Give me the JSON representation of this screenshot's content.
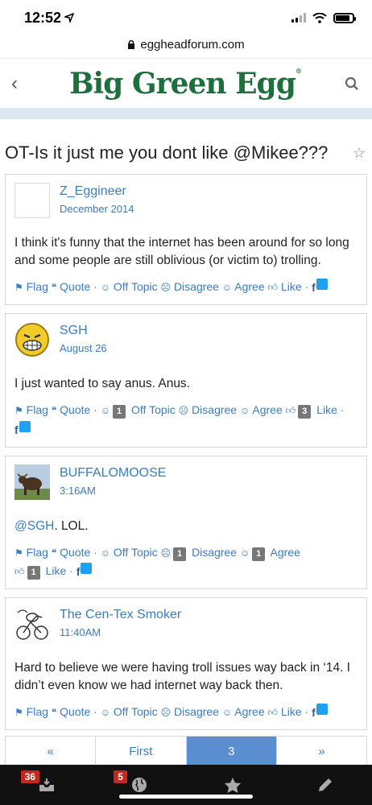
{
  "status": {
    "time": "12:52"
  },
  "browser": {
    "url": "eggheadforum.com"
  },
  "header": {
    "logo": "Big Green Egg"
  },
  "thread": {
    "title": "OT-Is it just me you dont like @Mikee???"
  },
  "reaction_labels": {
    "flag": "Flag",
    "quote": "Quote",
    "off_topic": "Off Topic",
    "disagree": "Disagree",
    "agree": "Agree",
    "like": "Like"
  },
  "posts": [
    {
      "author": "Z_Eggineer",
      "date": "December 2014",
      "body": "I think it's funny that the internet has been around for so long and some people are still oblivious (or victim to) trolling."
    },
    {
      "author": "SGH",
      "date": "August 26",
      "body": "I just wanted to say anus.  Anus.",
      "counts": {
        "off_topic": "1",
        "like": "3"
      }
    },
    {
      "author": "BUFFALOMOOSE",
      "date": "3:16AM",
      "mention": "@SGH",
      "body": ". LOL.",
      "counts": {
        "disagree": "1",
        "agree": "1",
        "like": "1"
      }
    },
    {
      "author": "The Cen-Tex Smoker",
      "date": "11:40AM",
      "body": "Hard to believe we were having troll issues way back in ‘14. I didn’t even know we had internet way back then."
    }
  ],
  "pager": {
    "prev": "«",
    "first": "First",
    "current": "3",
    "next": "»"
  },
  "bottom_bar": {
    "inbox_badge": "36",
    "notifications_badge": "5"
  }
}
